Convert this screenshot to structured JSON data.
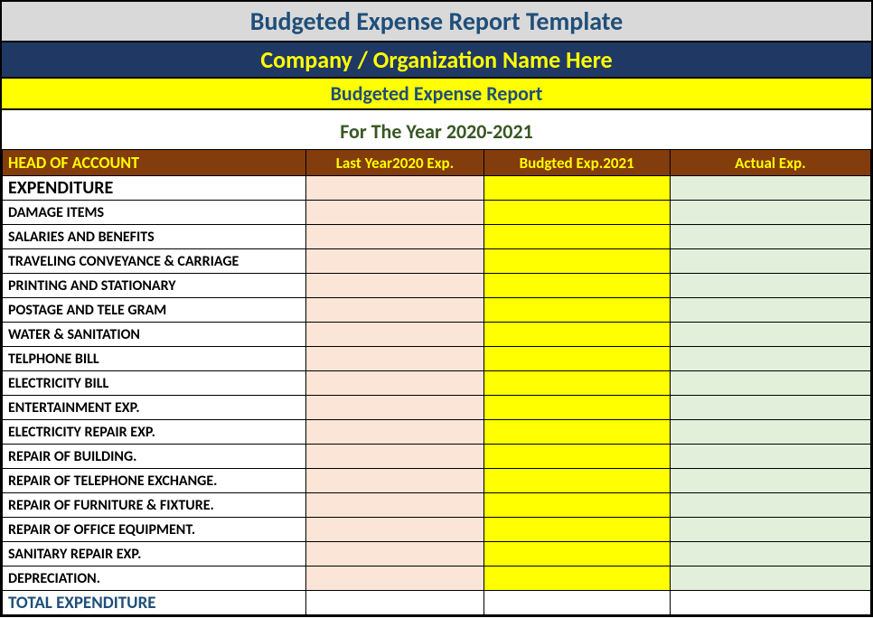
{
  "title": "Budgeted Expense Report Template",
  "company_placeholder": "Company / Organization Name Here",
  "report_title": "Budgeted Expense Report",
  "year_line": "For The Year 2020-2021",
  "columns": {
    "account": "HEAD OF ACCOUNT",
    "last_year": "Last Year2020 Exp.",
    "budgeted": "Budgted Exp.2021",
    "actual": "Actual Exp."
  },
  "category": "EXPENDITURE",
  "rows": [
    {
      "label": "DAMAGE ITEMS",
      "last": "",
      "budget": "",
      "actual": ""
    },
    {
      "label": "SALARIES AND BENEFITS",
      "last": "",
      "budget": "",
      "actual": ""
    },
    {
      "label": "TRAVELING CONVEYANCE & CARRIAGE",
      "last": "",
      "budget": "",
      "actual": ""
    },
    {
      "label": "PRINTING AND STATIONARY",
      "last": "",
      "budget": "",
      "actual": ""
    },
    {
      "label": "POSTAGE AND TELE GRAM",
      "last": "",
      "budget": "",
      "actual": ""
    },
    {
      "label": "WATER & SANITATION",
      "last": "",
      "budget": "",
      "actual": ""
    },
    {
      "label": "TELPHONE BILL",
      "last": "",
      "budget": "",
      "actual": ""
    },
    {
      "label": "ELECTRICITY BILL",
      "last": "",
      "budget": "",
      "actual": ""
    },
    {
      "label": "ENTERTAINMENT EXP.",
      "last": "",
      "budget": "",
      "actual": ""
    },
    {
      "label": "ELECTRICITY REPAIR EXP.",
      "last": "",
      "budget": "",
      "actual": ""
    },
    {
      "label": "REPAIR OF BUILDING.",
      "last": "",
      "budget": "",
      "actual": ""
    },
    {
      "label": "REPAIR OF TELEPHONE EXCHANGE.",
      "last": "",
      "budget": "",
      "actual": ""
    },
    {
      "label": "REPAIR OF FURNITURE & FIXTURE.",
      "last": "",
      "budget": "",
      "actual": ""
    },
    {
      "label": "REPAIR OF OFFICE EQUIPMENT.",
      "last": "",
      "budget": "",
      "actual": ""
    },
    {
      "label": "SANITARY REPAIR EXP.",
      "last": "",
      "budget": "",
      "actual": ""
    },
    {
      "label": "DEPRECIATION.",
      "last": "",
      "budget": "",
      "actual": ""
    }
  ],
  "total_label": "TOTAL EXPENDITURE"
}
